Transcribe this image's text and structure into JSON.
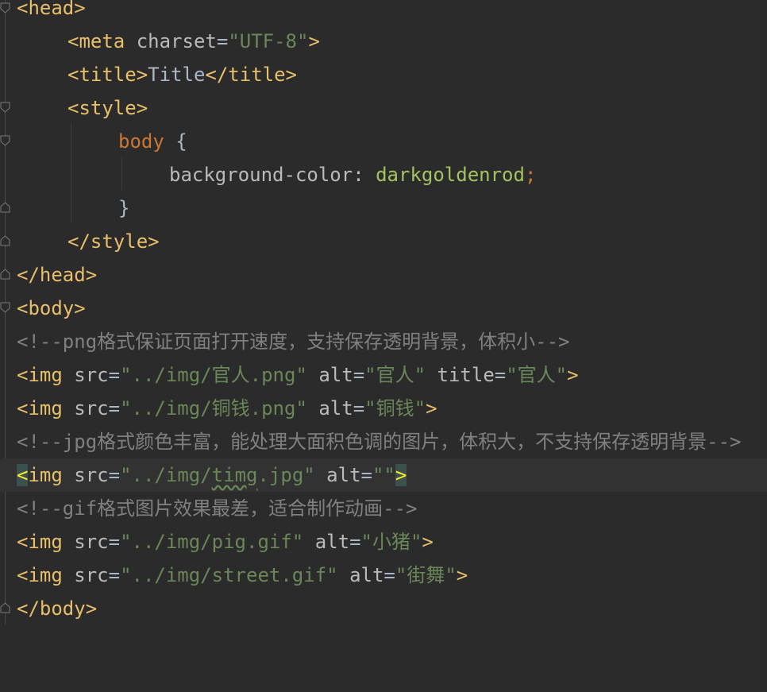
{
  "code": {
    "head_open": "<head>",
    "meta": {
      "open": "<meta",
      "attr": "charset",
      "eq": "=",
      "value": "\"UTF-8\"",
      "close": ">"
    },
    "title": {
      "open": "<title>",
      "text": "Title",
      "close": "</title>"
    },
    "style_open": "<style>",
    "css_selector": "body",
    "css_brace_open": "{",
    "css_property": "background-color:",
    "css_value": "darkgoldenrod",
    "css_semicolon": ";",
    "css_brace_close": "}",
    "style_close": "</style>",
    "head_close": "</head>",
    "body_open": "<body>",
    "comment_png": "<!--png格式保证页面打开速度，支持保存透明背景，体积小-->",
    "img1": {
      "open": "<img",
      "src_attr": "src",
      "src_val": "\"../img/官人.png\"",
      "alt_attr": "alt",
      "alt_val": "\"官人\"",
      "title_attr": "title",
      "title_val": "\"官人\"",
      "close": ">"
    },
    "img2": {
      "open": "<img",
      "src_attr": "src",
      "src_val": "\"../img/铜钱.png\"",
      "alt_attr": "alt",
      "alt_val": "\"铜钱\"",
      "close": ">"
    },
    "comment_jpg": "<!--jpg格式颜色丰富，能处理大面积色调的图片，体积大，不支持保存透明背景-->",
    "img3": {
      "lt": "<",
      "name": "img",
      "src_attr": "src",
      "src_pre": "\"../img/",
      "src_squiggle": "timg",
      "src_post": ".jpg\"",
      "alt_attr": "alt",
      "alt_val": "\"\"",
      "close": ">"
    },
    "comment_gif": "<!--gif格式图片效果最差，适合制作动画-->",
    "img4": {
      "open": "<img",
      "src_attr": "src",
      "src_val": "\"../img/pig.gif\"",
      "alt_attr": "alt",
      "alt_val": "\"小猪\"",
      "close": ">"
    },
    "img5": {
      "open": "<img",
      "src_attr": "src",
      "src_val": "\"../img/street.gif\"",
      "alt_attr": "alt",
      "alt_val": "\"街舞\"",
      "close": ">"
    },
    "body_close": "</body>"
  },
  "colors": {
    "background": "#2b2b2b",
    "current_line": "#323232",
    "tag": "#e8bf6a",
    "attribute": "#bababa",
    "string": "#6a8759",
    "css_selector": "#cc7832",
    "css_value": "#a5c261",
    "comment": "#808080",
    "bracket_match": "#ffef28"
  }
}
